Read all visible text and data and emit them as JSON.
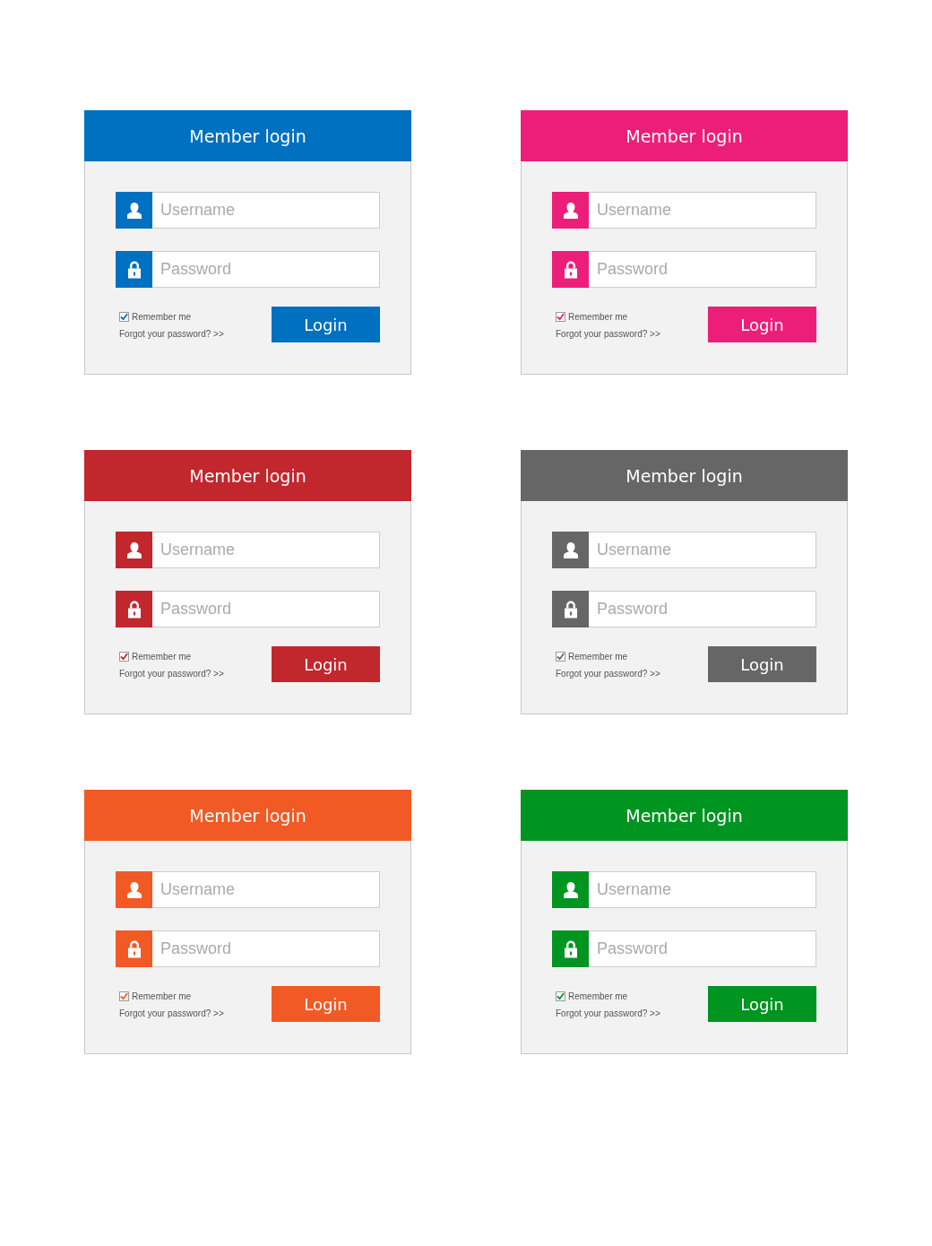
{
  "cards": [
    {
      "color": "#0070c0",
      "title": "Member login",
      "username": {
        "placeholder": "Username"
      },
      "password": {
        "placeholder": "Password"
      },
      "remember": {
        "label": "Remember me",
        "checked": true
      },
      "forgot": "Forgot your password? >>",
      "button": "Login"
    },
    {
      "color": "#ed1e79",
      "title": "Member login",
      "username": {
        "placeholder": "Username"
      },
      "password": {
        "placeholder": "Password"
      },
      "remember": {
        "label": "Remember me",
        "checked": true
      },
      "forgot": "Forgot your password? >>",
      "button": "Login"
    },
    {
      "color": "#c1272d",
      "title": "Member login",
      "username": {
        "placeholder": "Username"
      },
      "password": {
        "placeholder": "Password"
      },
      "remember": {
        "label": "Remember me",
        "checked": true
      },
      "forgot": "Forgot your password? >>",
      "button": "Login"
    },
    {
      "color": "#666666",
      "title": "Member login",
      "username": {
        "placeholder": "Username"
      },
      "password": {
        "placeholder": "Password"
      },
      "remember": {
        "label": "Remember me",
        "checked": true
      },
      "forgot": "Forgot your password? >>",
      "button": "Login"
    },
    {
      "color": "#f15a24",
      "title": "Member login",
      "username": {
        "placeholder": "Username"
      },
      "password": {
        "placeholder": "Password"
      },
      "remember": {
        "label": "Remember me",
        "checked": true
      },
      "forgot": "Forgot your password? >>",
      "button": "Login"
    },
    {
      "color": "#009420",
      "title": "Member login",
      "username": {
        "placeholder": "Username"
      },
      "password": {
        "placeholder": "Password"
      },
      "remember": {
        "label": "Remember me",
        "checked": true
      },
      "forgot": "Forgot your password? >>",
      "button": "Login"
    }
  ]
}
